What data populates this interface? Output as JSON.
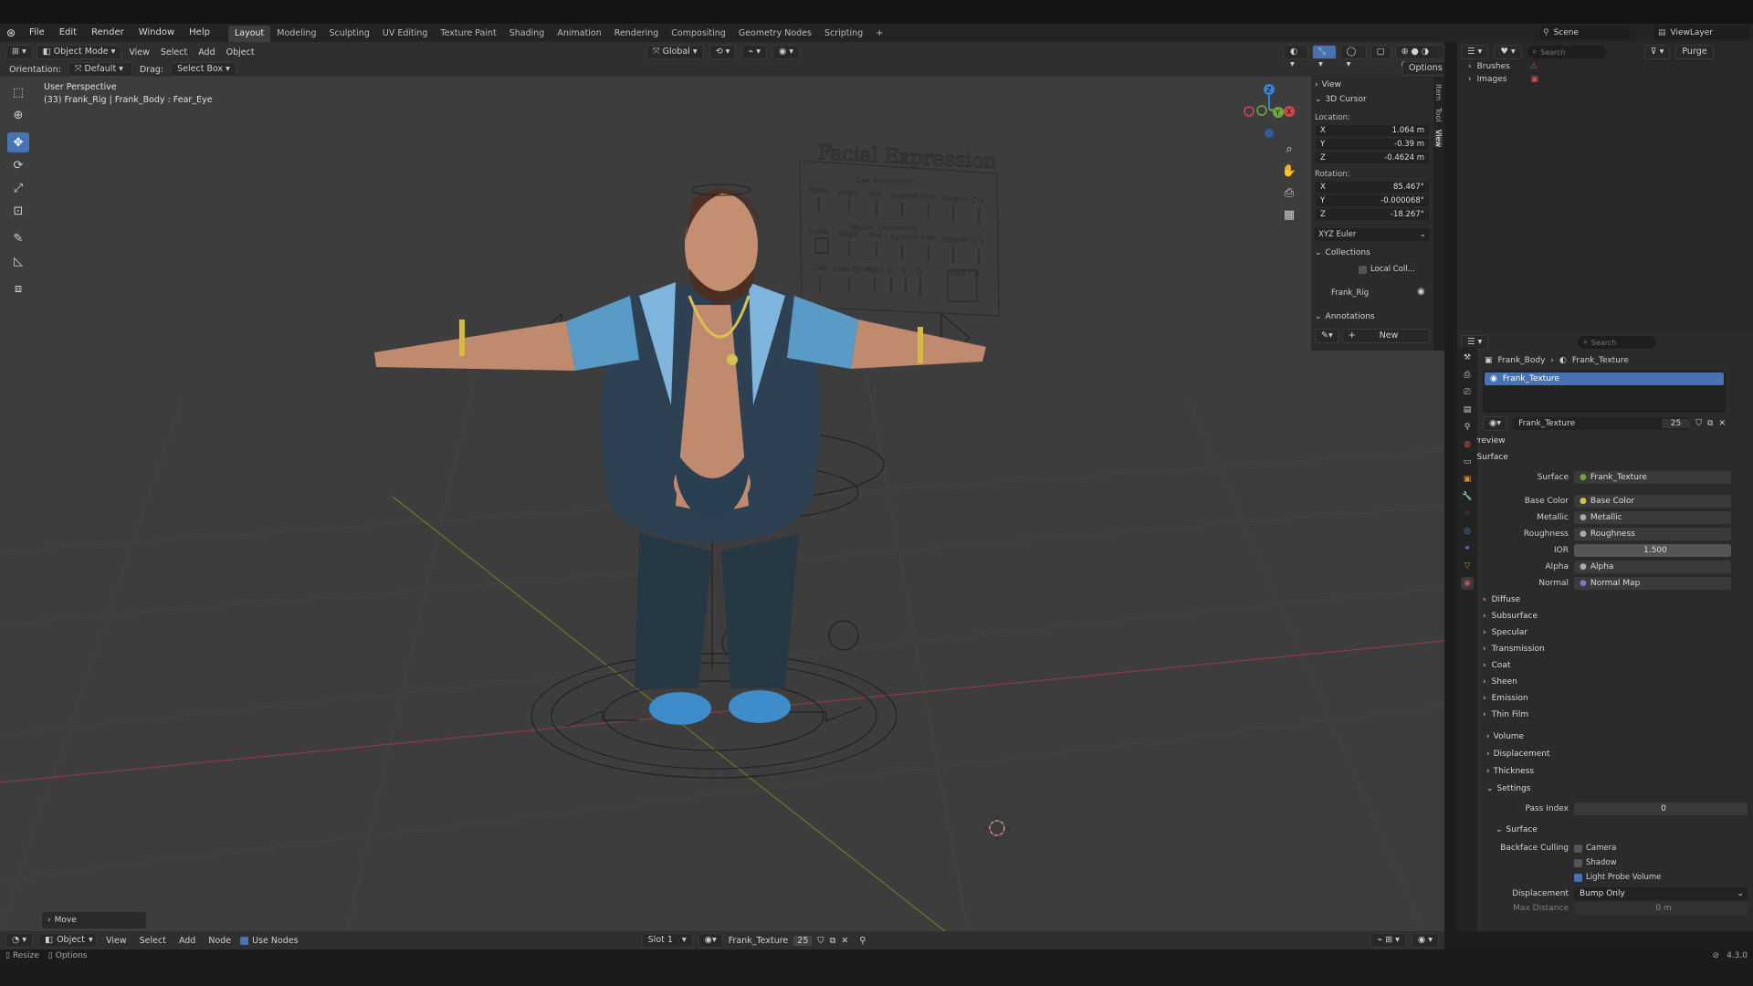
{
  "menubar": {
    "items": [
      "File",
      "Edit",
      "Render",
      "Window",
      "Help"
    ],
    "workspaces": [
      "Layout",
      "Modeling",
      "Sculpting",
      "UV Editing",
      "Texture Paint",
      "Shading",
      "Animation",
      "Rendering",
      "Compositing",
      "Geometry Nodes",
      "Scripting"
    ],
    "active_workspace": "Layout",
    "add_tab": "+",
    "scene_label": "Scene",
    "viewlayer_label": "ViewLayer"
  },
  "viewport_header": {
    "mode": "Object Mode",
    "menus": [
      "View",
      "Select",
      "Add",
      "Object"
    ],
    "transform_orientation": "Global",
    "orientation_label": "Orientation:",
    "orientation_value": "Default",
    "drag_label": "Drag:",
    "drag_value": "Select Box",
    "options": "Options"
  },
  "viewport": {
    "perspective": "User Perspective",
    "active_object": "(33) Frank_Rig | Frank_Body : Fear_Eye",
    "board_title": "Facial Expression",
    "board_eye": "Eye_Expression",
    "board_mouth": "Mouth_Expression",
    "board_labels_row1": [
      "Smile",
      "Angry",
      "Sad",
      "Surprise",
      "Fear",
      "Disgust",
      "Cry"
    ],
    "board_labels_row2": [
      "Smile",
      "Angry",
      "Sad",
      "Surprise",
      "Fear",
      "Disgust",
      "Cry"
    ],
    "board_labels_row3": [
      "Cute",
      "Cute Smile",
      "Kiss",
      "A",
      "E",
      "O"
    ],
    "board_labels_row3b": "Blink L R",
    "gizmo_axes": [
      "X",
      "Y",
      "Z"
    ],
    "last_operator": "Move"
  },
  "npanel": {
    "view_label": "View",
    "cursor_label": "3D Cursor",
    "location_label": "Location:",
    "location": [
      {
        "axis": "X",
        "value": "1.064 m"
      },
      {
        "axis": "Y",
        "value": "-0.39 m"
      },
      {
        "axis": "Z",
        "value": "-0.4624 m"
      }
    ],
    "rotation_label": "Rotation:",
    "rotation": [
      {
        "axis": "X",
        "value": "85.467°"
      },
      {
        "axis": "Y",
        "value": "-0.000068°"
      },
      {
        "axis": "Z",
        "value": "-18.267°"
      }
    ],
    "rotation_mode": "XYZ Euler",
    "collections_label": "Collections",
    "local_coll": "Local Coll...",
    "rig_name": "Frank_Rig",
    "annotations_label": "Annotations",
    "new_label": "New",
    "tabs": [
      "Item",
      "Tool",
      "View"
    ]
  },
  "outliner": {
    "search_placeholder": "Search",
    "purge": "Purge",
    "items": [
      "Brushes",
      "Images"
    ]
  },
  "properties": {
    "search_placeholder": "Search",
    "breadcrumb_object": "Frank_Body",
    "breadcrumb_material": "Frank_Texture",
    "slot_name": "Frank_Texture",
    "material_name": "Frank_Texture",
    "users": "25",
    "preview": "Preview",
    "surface": "Surface",
    "rows": [
      {
        "label": "Surface",
        "value": "Frank_Texture"
      },
      {
        "label": "Base Color",
        "value": "Base Color"
      },
      {
        "label": "Metallic",
        "value": "Metallic"
      },
      {
        "label": "Roughness",
        "value": "Roughness"
      },
      {
        "label": "IOR",
        "value": "1.500"
      },
      {
        "label": "Alpha",
        "value": "Alpha"
      },
      {
        "label": "Normal",
        "value": "Normal Map"
      }
    ],
    "subpanels": [
      "Diffuse",
      "Subsurface",
      "Specular",
      "Transmission",
      "Coat",
      "Sheen",
      "Emission",
      "Thin Film"
    ],
    "panels": [
      "Volume",
      "Displacement",
      "Thickness",
      "Settings"
    ],
    "pass_index_label": "Pass Index",
    "pass_index": "0",
    "settings_surface": "Surface",
    "backface_label": "Backface Culling",
    "backface_opts": [
      {
        "label": "Camera",
        "on": false
      },
      {
        "label": "Shadow",
        "on": false
      },
      {
        "label": "Light Probe Volume",
        "on": true
      }
    ],
    "displacement_label": "Displacement",
    "displacement_value": "Bump Only",
    "max_distance_label": "Max Distance",
    "max_distance": "0 m"
  },
  "nodebar": {
    "mode": "Object",
    "menus": [
      "View",
      "Select",
      "Add",
      "Node"
    ],
    "use_nodes": "Use Nodes",
    "slot": "Slot 1",
    "material": "Frank_Texture",
    "users": "25"
  },
  "statusbar": {
    "left1": "Resize",
    "left2": "Options",
    "version": "4.3.0"
  },
  "colors": {
    "accent": "#4772b3",
    "viewport": "#3d3d3d",
    "panel": "#2b2b2b"
  }
}
